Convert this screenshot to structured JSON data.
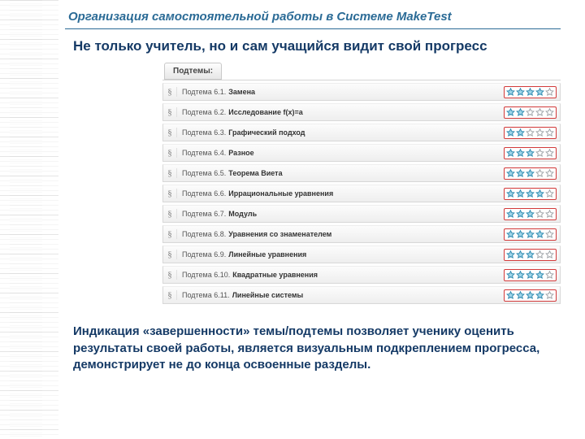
{
  "title": "Организация самостоятельной работы в Системе MakeTest",
  "subtitle": "Не только учитель, но и сам учащийся видит свой прогресс",
  "panel_header": "Подтемы:",
  "max_stars": 5,
  "rows": [
    {
      "prefix": "Подтема 6.1.",
      "name": "Замена",
      "stars": 4
    },
    {
      "prefix": "Подтема 6.2.",
      "name": "Исследование f(x)=a",
      "stars": 2
    },
    {
      "prefix": "Подтема 6.3.",
      "name": "Графический подход",
      "stars": 2
    },
    {
      "prefix": "Подтема 6.4.",
      "name": "Разное",
      "stars": 3
    },
    {
      "prefix": "Подтема 6.5.",
      "name": "Теорема Виета",
      "stars": 3
    },
    {
      "prefix": "Подтема 6.6.",
      "name": "Иррациональные уравнения",
      "stars": 4
    },
    {
      "prefix": "Подтема 6.7.",
      "name": "Модуль",
      "stars": 3
    },
    {
      "prefix": "Подтема 6.8.",
      "name": "Уравнения со знаменателем",
      "stars": 4
    },
    {
      "prefix": "Подтема 6.9.",
      "name": "Линейные уравнения",
      "stars": 3
    },
    {
      "prefix": "Подтема 6.10.",
      "name": "Квадратные уравнения",
      "stars": 4
    },
    {
      "prefix": "Подтема 6.11.",
      "name": "Линейные системы",
      "stars": 4
    }
  ],
  "footer": "Индикация «завершенности» темы/подтемы позволяет ученику оценить результаты своей работы, является визуальным подкреплением прогресса, демонстрирует не до конца освоенные разделы."
}
